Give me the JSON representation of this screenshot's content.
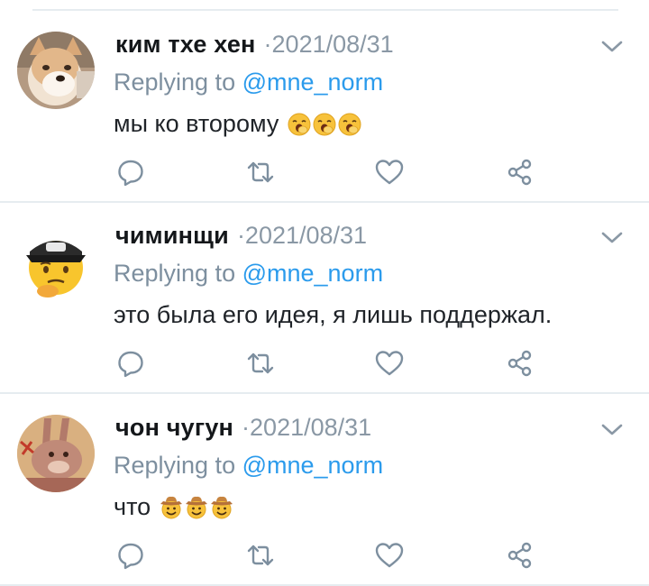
{
  "colors": {
    "name": "#14171a",
    "muted": "#8a98a5",
    "link": "#2b9bec",
    "icon": "#7d8f9f",
    "divider": "#e6ecf0"
  },
  "icons": [
    "chevron-down-icon",
    "reply-icon",
    "retweet-icon",
    "like-icon",
    "share-icon"
  ],
  "tweets": [
    {
      "author": "ким тхе хен",
      "date": "·2021/08/31",
      "reply_prefix": "Replying to ",
      "reply_handle": "@mne_norm",
      "text": "мы ко второму",
      "emojis": [
        "yawning-face",
        "yawning-face",
        "yawning-face"
      ],
      "avatar": "shiba-dog-avatar"
    },
    {
      "author": "чиминщи",
      "date": "·2021/08/31",
      "reply_prefix": "Replying to ",
      "reply_handle": "@mne_norm",
      "text": "это была его идея, я лишь поддержал.",
      "emojis": [],
      "avatar": "thinking-emoji-cap-avatar"
    },
    {
      "author": "чон чугун",
      "date": "·2021/08/31",
      "reply_prefix": "Replying to ",
      "reply_handle": "@mne_norm",
      "text": "что",
      "emojis": [
        "cowboy-face",
        "cowboy-face",
        "cowboy-face"
      ],
      "avatar": "cartoon-rabbit-avatar"
    }
  ]
}
